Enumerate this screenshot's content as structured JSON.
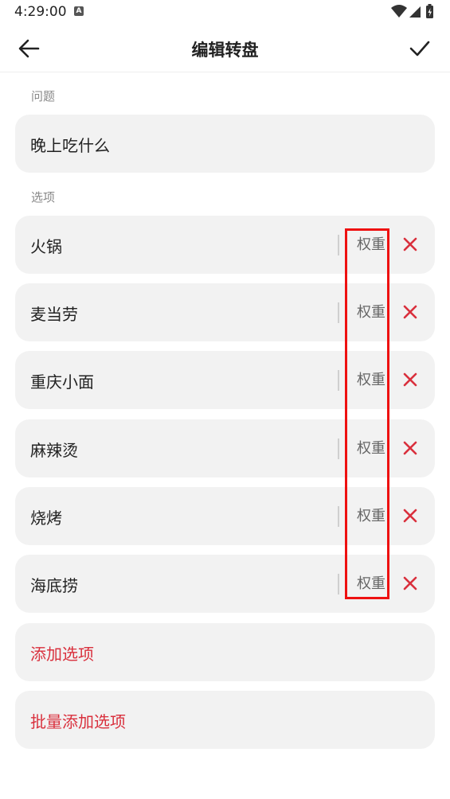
{
  "status_bar": {
    "time": "4:29:00",
    "notification_icon": "A",
    "icons": [
      "wifi-icon",
      "cell-signal-icon",
      "battery-charging-icon"
    ]
  },
  "app_bar": {
    "title": "编辑转盘",
    "back_icon": "arrow-left-icon",
    "confirm_icon": "check-icon"
  },
  "question": {
    "label": "问题",
    "value": "晚上吃什么"
  },
  "options": {
    "label": "选项",
    "weight_placeholder": "权重",
    "items": [
      {
        "name": "火锅",
        "weight_label": "权重"
      },
      {
        "name": "麦当劳",
        "weight_label": "权重"
      },
      {
        "name": "重庆小面",
        "weight_label": "权重"
      },
      {
        "name": "麻辣烫",
        "weight_label": "权重"
      },
      {
        "name": "烧烤",
        "weight_label": "权重"
      },
      {
        "name": "海底捞",
        "weight_label": "权重"
      }
    ]
  },
  "actions": {
    "add_option": "添加选项",
    "batch_add_option": "批量添加选项"
  },
  "colors": {
    "accent": "#d9303d",
    "card_bg": "#f2f2f2",
    "highlight": "#ee1111"
  }
}
